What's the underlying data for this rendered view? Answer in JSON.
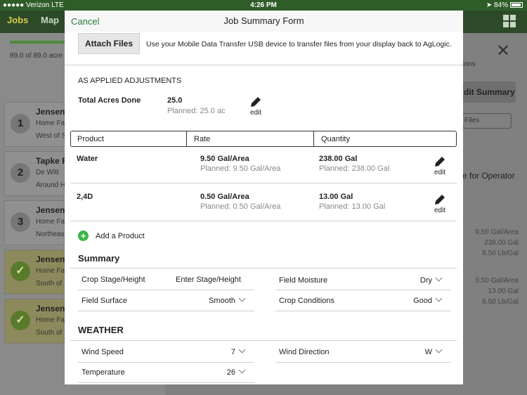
{
  "status_bar": {
    "carrier": "●●●●● Verizon  LTE",
    "time": "4:26 PM",
    "battery": "84%"
  },
  "background": {
    "tabs": [
      "Jobs",
      "Map"
    ],
    "acres_text": "89.0 of 89.0 acre",
    "jobs": [
      {
        "num": "1",
        "name": "Jensen",
        "sub1": "Home Fa",
        "sub2": "West of S",
        "done": false
      },
      {
        "num": "2",
        "name": "Tapke F",
        "sub1": "De Witt",
        "sub2": "Around H",
        "done": false
      },
      {
        "num": "3",
        "name": "Jensen",
        "sub1": "Home Fa",
        "sub2": "Northeas",
        "done": false
      },
      {
        "num": "✓",
        "name": "Jensen",
        "sub1": "Home Fa",
        "sub2": "South of",
        "done": true
      },
      {
        "num": "✓",
        "name": "Jensen",
        "sub1": "Home Fa",
        "sub2": "South of",
        "done": true
      }
    ],
    "right_ions": "ions",
    "summary_btn": "dit Summary",
    "files_btn": "Files",
    "operator_text": "e for Operator",
    "values": [
      "9.50 Gal/Area",
      "238.00 Gal",
      "8.50 Lb/Gal",
      "0.50 Gal/Area",
      "13.00 Gal",
      "8.50 Lb/Gal"
    ]
  },
  "modal": {
    "cancel": "Cancel",
    "title": "Job Summary Form",
    "attach_label": "Attach Files",
    "attach_text": "Use your Mobile Data Transfer USB device to transfer files from your display back to AgLogic.",
    "adjustments_label": "AS APPLIED ADJUSTMENTS",
    "acres": {
      "label": "Total Acres Done",
      "value": "25.0",
      "planned": "Planned: 25.0 ac",
      "edit": "edit"
    },
    "table_headers": [
      "Product",
      "Rate",
      "Quantity"
    ],
    "products": [
      {
        "name": "Water",
        "rate": "9.50 Gal/Area",
        "rate_planned": "Planned: 9.50 Gal/Area",
        "qty": "238.00 Gal",
        "qty_planned": "Planned: 238.00 Gal",
        "edit": "edit"
      },
      {
        "name": "2,4D",
        "rate": "0.50 Gal/Area",
        "rate_planned": "Planned: 0.50 Gal/Area",
        "qty": "13.00 Gal",
        "qty_planned": "Planned: 13.00 Gal",
        "edit": "edit"
      }
    ],
    "add_product": "Add a Product",
    "summary_heading": "Summary",
    "summary_fields": {
      "crop_stage": {
        "label": "Crop Stage/Height",
        "placeholder": "Enter Stage/Height"
      },
      "field_moisture": {
        "label": "Field Moisture",
        "value": "Dry"
      },
      "field_surface": {
        "label": "Field Surface",
        "value": "Smooth"
      },
      "crop_conditions": {
        "label": "Crop Conditions",
        "value": "Good"
      }
    },
    "weather_heading": "WEATHER",
    "weather_fields": {
      "wind_speed": {
        "label": "Wind Speed",
        "value": "7"
      },
      "wind_direction": {
        "label": "Wind Direction",
        "value": "W"
      },
      "temperature": {
        "label": "Temperature",
        "value": "26"
      }
    }
  }
}
